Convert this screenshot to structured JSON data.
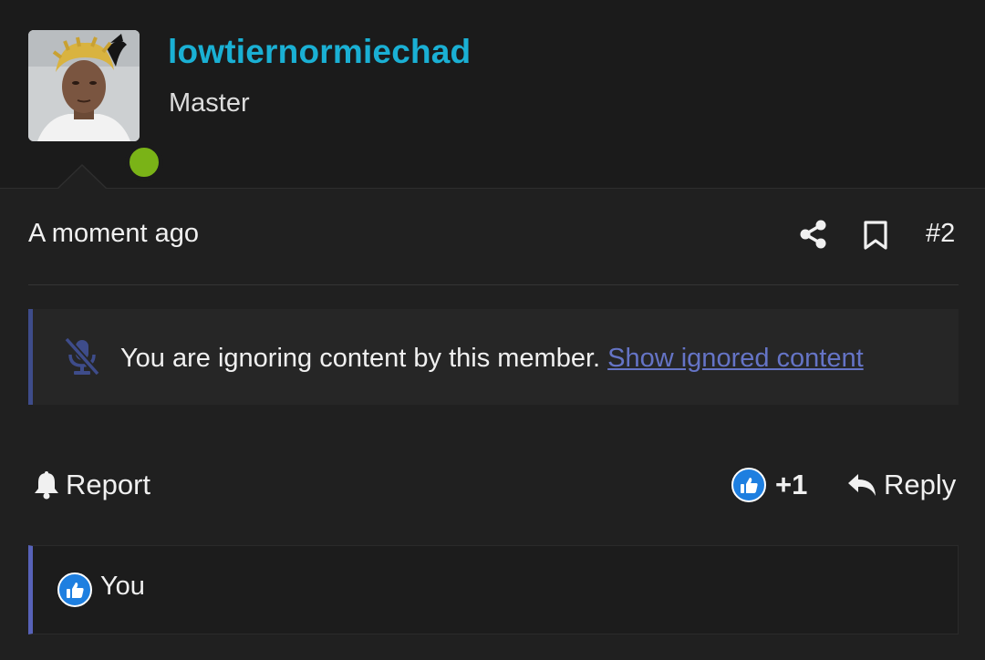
{
  "user": {
    "username": "lowtiernormiechad",
    "title": "Master",
    "status": "online",
    "status_color": "#7ab317",
    "username_color": "#1ab0d4"
  },
  "post": {
    "timestamp": "A moment ago",
    "number": "#2",
    "icons": [
      "share-icon",
      "bookmark-icon"
    ]
  },
  "notice": {
    "icon": "mute-icon",
    "text": "You are ignoring content by this member.",
    "link_label": "Show ignored content",
    "link_color": "#6574c6"
  },
  "actions": {
    "report_label": "Report",
    "like_count": "+1",
    "reply_label": "Reply"
  },
  "reactions": {
    "icon": "like-icon",
    "user": "You",
    "accent": "#5762b8"
  }
}
